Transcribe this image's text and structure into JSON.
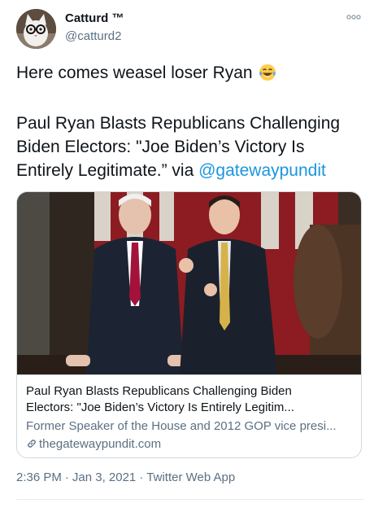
{
  "author": {
    "display_name": "Catturd ™",
    "handle": "@catturd2"
  },
  "tweet": {
    "line1": "Here comes weasel loser Ryan",
    "emoji": "face-with-tears-of-joy",
    "line2": "Paul Ryan Blasts Republicans Challenging Biden Electors:  \"Joe Biden’s Victory Is Entirely Legitimate.” via ",
    "mention": "@gatewaypundit"
  },
  "card": {
    "title_line1": "Paul Ryan Blasts Republicans Challenging Biden",
    "title_line2": "Electors: \"Joe Biden’s Victory Is Entirely Legitim...",
    "description": "Former Speaker of the House and 2012 GOP vice presi...",
    "domain": "thegatewaypundit.com"
  },
  "meta": {
    "time": "2:36 PM",
    "date": "Jan 3, 2021",
    "separator": "·",
    "source": "Twitter Web App"
  },
  "colors": {
    "link": "#1b95e0",
    "secondary_text": "#5b7083",
    "primary_text": "#0f1419",
    "border": "#cfd9de"
  }
}
